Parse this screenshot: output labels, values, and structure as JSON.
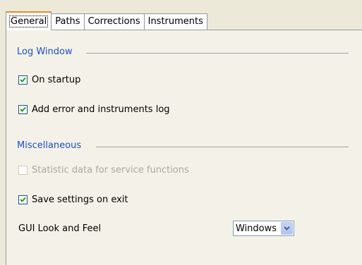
{
  "tabs": [
    {
      "label": "General",
      "active": true
    },
    {
      "label": "Paths",
      "active": false
    },
    {
      "label": "Corrections",
      "active": false
    },
    {
      "label": "Instruments",
      "active": false
    }
  ],
  "log_window": {
    "title": "Log Window",
    "on_startup": {
      "label": "On startup",
      "checked": true
    },
    "add_error_log": {
      "label": "Add error and instruments log",
      "checked": true
    }
  },
  "misc": {
    "title": "Miscellaneous",
    "statistic_data": {
      "label": "Statistic data for service functions",
      "checked": false,
      "disabled": true
    },
    "save_settings": {
      "label": "Save settings on exit",
      "checked": true
    }
  },
  "gui": {
    "label": "GUI Look and Feel",
    "selected": "Windows"
  },
  "colors": {
    "section_title": "#1c4fc6",
    "check": "#21a121",
    "active_tab_accent": "#e68b2c"
  }
}
